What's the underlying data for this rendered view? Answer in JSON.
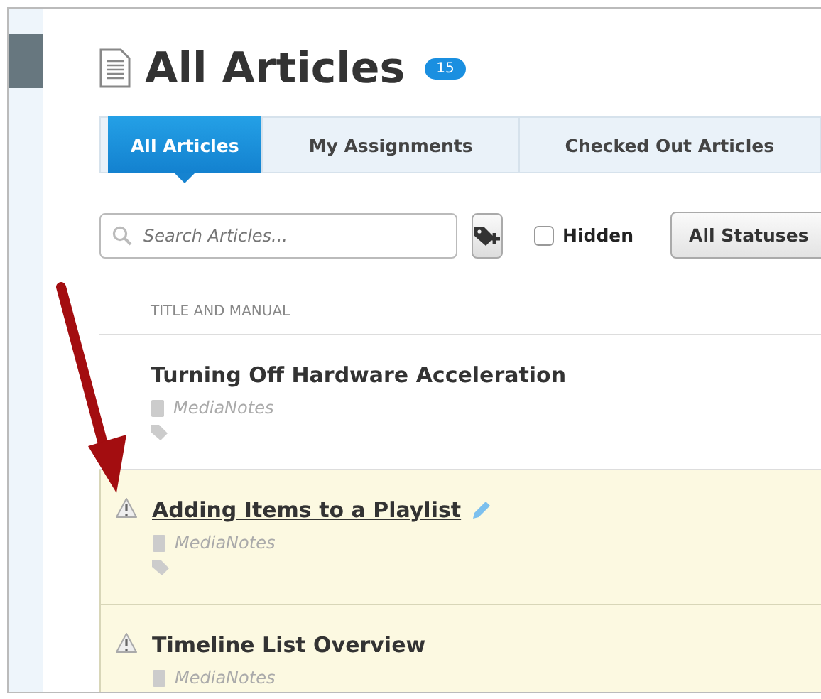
{
  "header": {
    "title": "All Articles",
    "count": "15"
  },
  "tabs": [
    {
      "label": "All Articles",
      "selected": true
    },
    {
      "label": "My Assignments",
      "selected": false
    },
    {
      "label": "Checked Out Articles",
      "selected": false
    }
  ],
  "toolbar": {
    "search": {
      "placeholder": "Search Articles..."
    },
    "hidden": {
      "label": "Hidden",
      "checked": false
    },
    "status_filter": "All Statuses"
  },
  "table": {
    "columns": [
      "TITLE AND MANUAL"
    ],
    "rows": [
      {
        "title": "Turning Off Hardware Acceleration",
        "manual": "MediaNotes",
        "warning": false,
        "highlighted": false,
        "hovered": false
      },
      {
        "title": "Adding Items to a Playlist",
        "manual": "MediaNotes",
        "warning": true,
        "highlighted": true,
        "hovered": true
      },
      {
        "title": "Timeline List Overview",
        "manual": "MediaNotes",
        "warning": true,
        "highlighted": true,
        "hovered": false
      }
    ]
  }
}
